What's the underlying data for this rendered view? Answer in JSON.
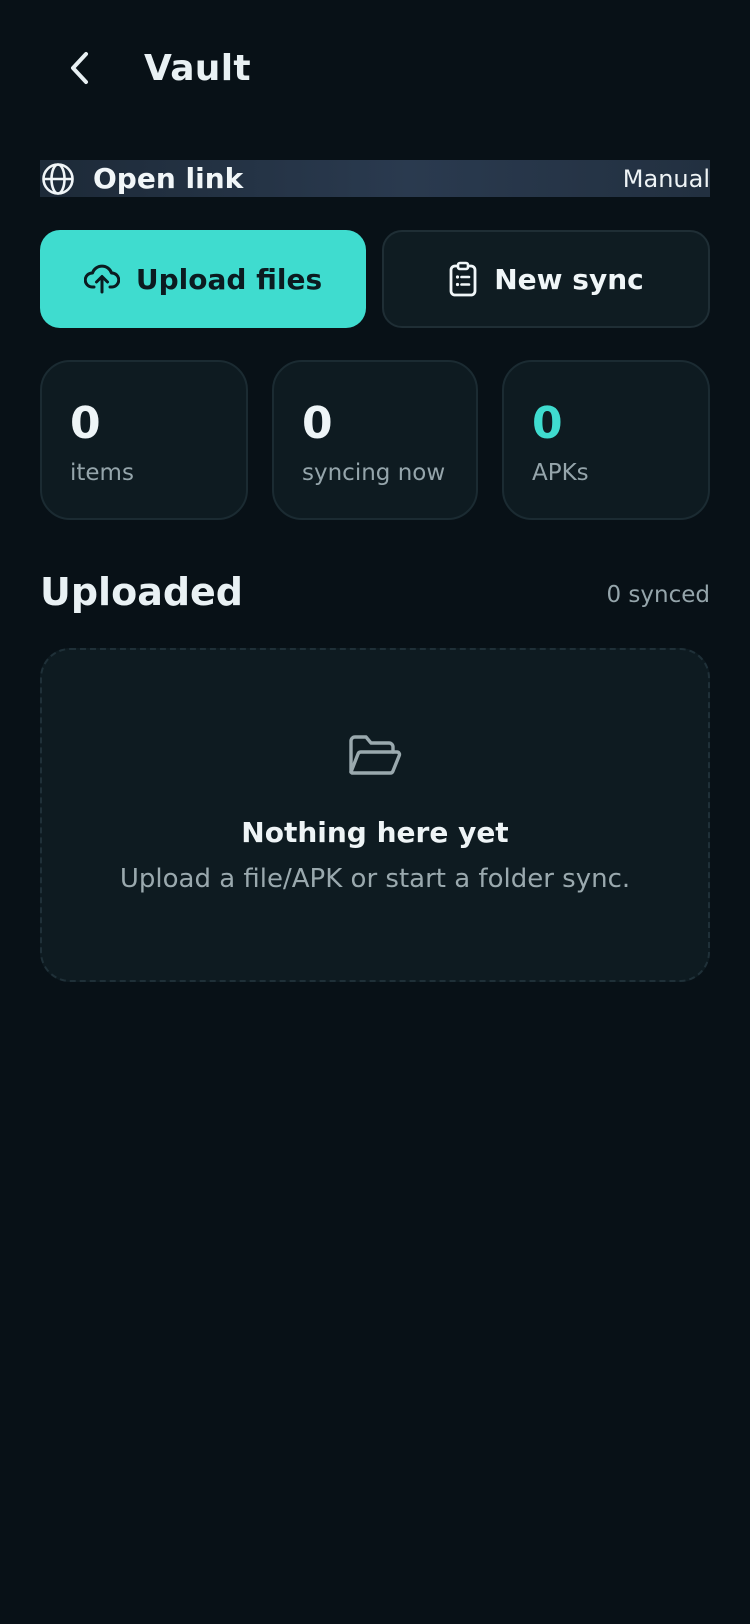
{
  "header": {
    "title": "Vault",
    "back_icon": "chevron-left-icon"
  },
  "link_bar": {
    "icon": "globe-icon",
    "label": "Open link",
    "mode": "Manual"
  },
  "actions": {
    "upload": {
      "label": "Upload files",
      "icon": "cloud-upload-icon"
    },
    "new_sync": {
      "label": "New sync",
      "icon": "clipboard-list-icon"
    }
  },
  "stats": [
    {
      "value": "0",
      "label": "items"
    },
    {
      "value": "0",
      "label": "syncing now"
    },
    {
      "value": "0",
      "label": "APKs"
    }
  ],
  "uploaded": {
    "title": "Uploaded",
    "meta": "0 synced",
    "empty": {
      "icon": "folder-open-icon",
      "title": "Nothing here yet",
      "description": "Upload a file/APK or start a folder sync."
    }
  },
  "colors": {
    "background": "#081117",
    "accent": "#3fdccf",
    "card": "#0e1b21",
    "muted_text": "#95a5ab"
  }
}
